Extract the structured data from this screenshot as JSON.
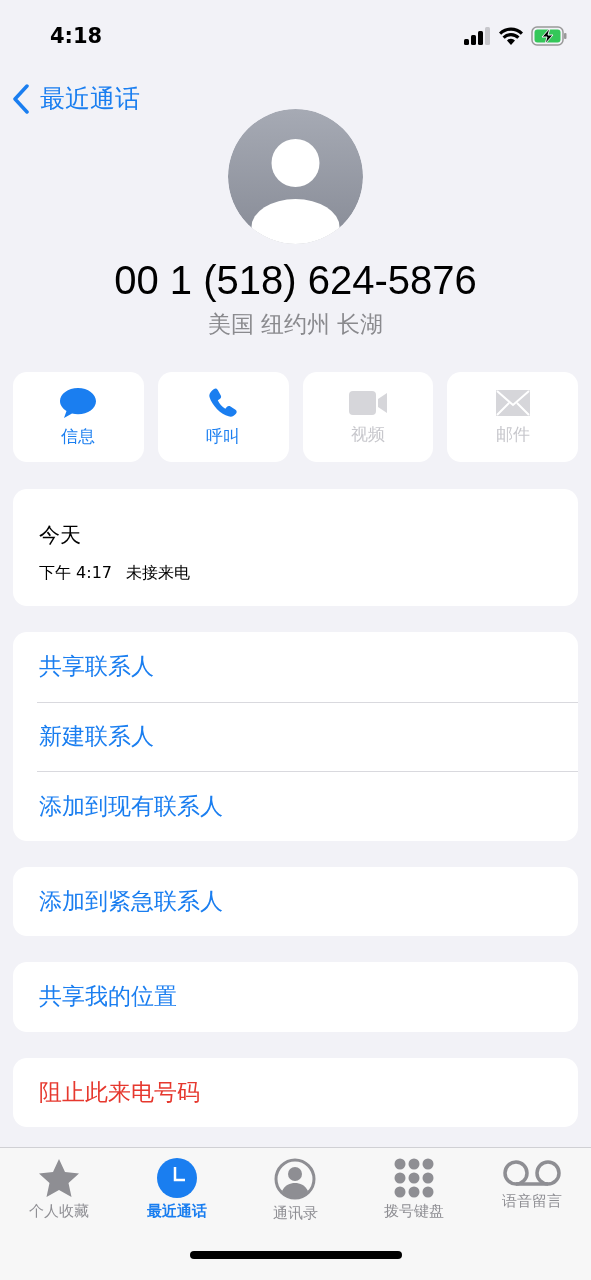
{
  "status_bar": {
    "time": "4:18"
  },
  "nav": {
    "back_label": "最近通话"
  },
  "contact": {
    "number": "00 1 (518) 624-5876",
    "location": "美国 纽约州 长湖"
  },
  "actions": [
    {
      "kind": "message",
      "label": "信息",
      "disabled": false
    },
    {
      "kind": "call",
      "label": "呼叫",
      "disabled": false
    },
    {
      "kind": "video",
      "label": "视频",
      "disabled": true
    },
    {
      "kind": "mail",
      "label": "邮件",
      "disabled": true
    }
  ],
  "recent": {
    "day": "今天",
    "time": "下午 4:17",
    "type": "未接来电"
  },
  "groups": [
    {
      "items": [
        {
          "label": "共享联系人",
          "destructive": false
        },
        {
          "label": "新建联系人",
          "destructive": false
        },
        {
          "label": "添加到现有联系人",
          "destructive": false
        }
      ]
    },
    {
      "items": [
        {
          "label": "添加到紧急联系人",
          "destructive": false
        }
      ]
    },
    {
      "items": [
        {
          "label": "共享我的位置",
          "destructive": false
        }
      ]
    },
    {
      "items": [
        {
          "label": "阻止此来电号码",
          "destructive": true
        }
      ]
    }
  ],
  "tab_bar": [
    {
      "kind": "favorites",
      "label": "个人收藏",
      "selected": false
    },
    {
      "kind": "recents",
      "label": "最近通话",
      "selected": true
    },
    {
      "kind": "contacts",
      "label": "通讯录",
      "selected": false
    },
    {
      "kind": "keypad",
      "label": "拨号键盘",
      "selected": false
    },
    {
      "kind": "voicemail",
      "label": "语音留言",
      "selected": false
    }
  ]
}
